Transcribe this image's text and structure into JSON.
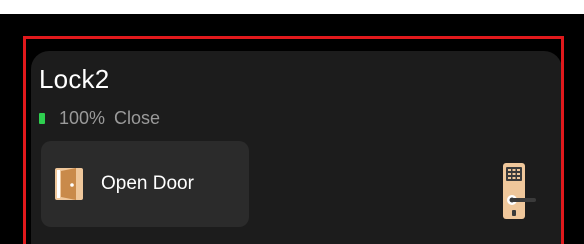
{
  "device": {
    "name": "Lock2",
    "battery": "100%",
    "state": "Close"
  },
  "actions": [
    {
      "label": "Open Door",
      "icon": "door-icon"
    }
  ],
  "icons": {
    "battery": "battery-icon",
    "device": "smart-lock-icon"
  },
  "colors": {
    "background": "#000000",
    "card": "#1c1c1c",
    "tile": "#2b2b2b",
    "highlight": "#e0191c",
    "battery": "#2ecf4f",
    "accent": "#e3b98a"
  }
}
